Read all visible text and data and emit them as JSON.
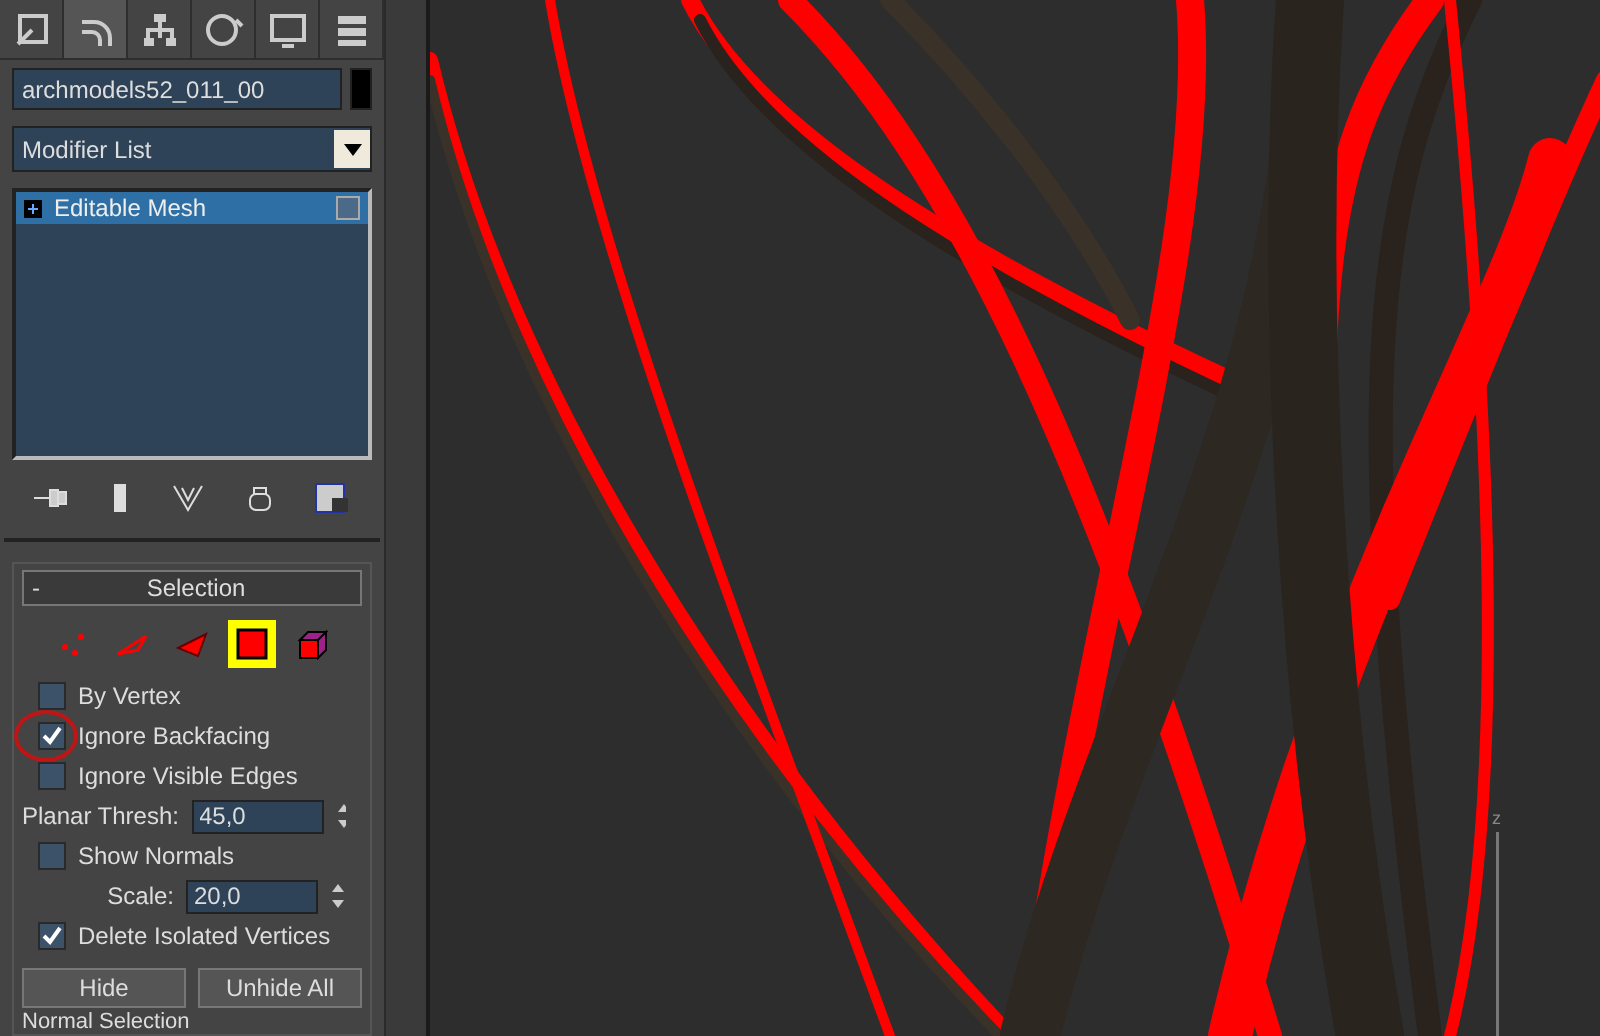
{
  "command_tabs": [
    {
      "kind": "create",
      "selected": false
    },
    {
      "kind": "modify",
      "selected": true
    },
    {
      "kind": "hierarchy",
      "selected": false
    },
    {
      "kind": "motion",
      "selected": false
    },
    {
      "kind": "display",
      "selected": false
    },
    {
      "kind": "utilities",
      "selected": false
    }
  ],
  "object_name": "archmodels52_011_00",
  "modifier_list": {
    "label": "Modifier List"
  },
  "stack": [
    {
      "label": "Editable Mesh",
      "selected": true
    }
  ],
  "selection": {
    "title": "Selection",
    "collapse": "-",
    "levels": [
      {
        "kind": "vertex",
        "selected": false
      },
      {
        "kind": "edge",
        "selected": false
      },
      {
        "kind": "face",
        "selected": false
      },
      {
        "kind": "polygon",
        "selected": true
      },
      {
        "kind": "element",
        "selected": false
      }
    ],
    "options": [
      {
        "kind": "check",
        "label": "By Vertex",
        "checked": false
      },
      {
        "kind": "check",
        "label": "Ignore Backfacing",
        "checked": true,
        "circled": true
      },
      {
        "kind": "check",
        "label": "Ignore Visible Edges",
        "checked": false
      },
      {
        "kind": "spinner",
        "label": "Planar Thresh:",
        "value": "45,0"
      },
      {
        "kind": "check",
        "label": "Show Normals",
        "checked": false
      },
      {
        "kind": "spinner",
        "label": "Scale:",
        "value": "20,0"
      },
      {
        "kind": "check",
        "label": "Delete Isolated Vertices",
        "checked": true
      }
    ],
    "buttons": [
      "Hide",
      "Unhide All"
    ],
    "next_section": "Normal Selection"
  },
  "viewport": {
    "axis_label": "z"
  }
}
